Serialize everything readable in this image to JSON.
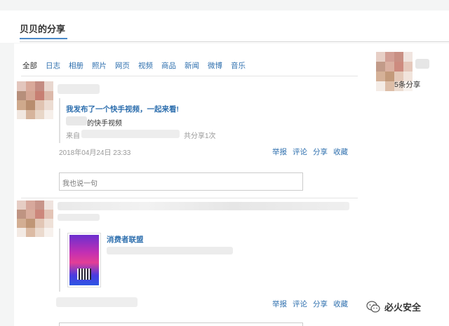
{
  "header": {
    "title": "贝贝的分享"
  },
  "tabs": [
    {
      "label": "全部",
      "active": true
    },
    {
      "label": "日志"
    },
    {
      "label": "相册"
    },
    {
      "label": "照片"
    },
    {
      "label": "网页"
    },
    {
      "label": "视频"
    },
    {
      "label": "商品"
    },
    {
      "label": "新闻"
    },
    {
      "label": "微博"
    },
    {
      "label": "音乐"
    }
  ],
  "feed": [
    {
      "share_title": "我发布了一个快手视频，一起来看!",
      "share_subtitle": "的快手视频",
      "source_prefix": "来自",
      "share_count": "共分享1次",
      "timestamp": "2018年04月24日 23:33",
      "actions": [
        "举报",
        "评论",
        "分享",
        "收藏"
      ],
      "comment_placeholder": "我也说一句"
    },
    {
      "card_title": "消费者联盟",
      "actions": [
        "举报",
        "评论",
        "分享",
        "收藏"
      ]
    }
  ],
  "right_panel": {
    "share_count_text": "5条分享"
  },
  "watermark": {
    "text": "必火安全"
  },
  "colors": {
    "link": "#2e6fae",
    "accent": "#4a89c8",
    "background": "#f4f5f5"
  }
}
